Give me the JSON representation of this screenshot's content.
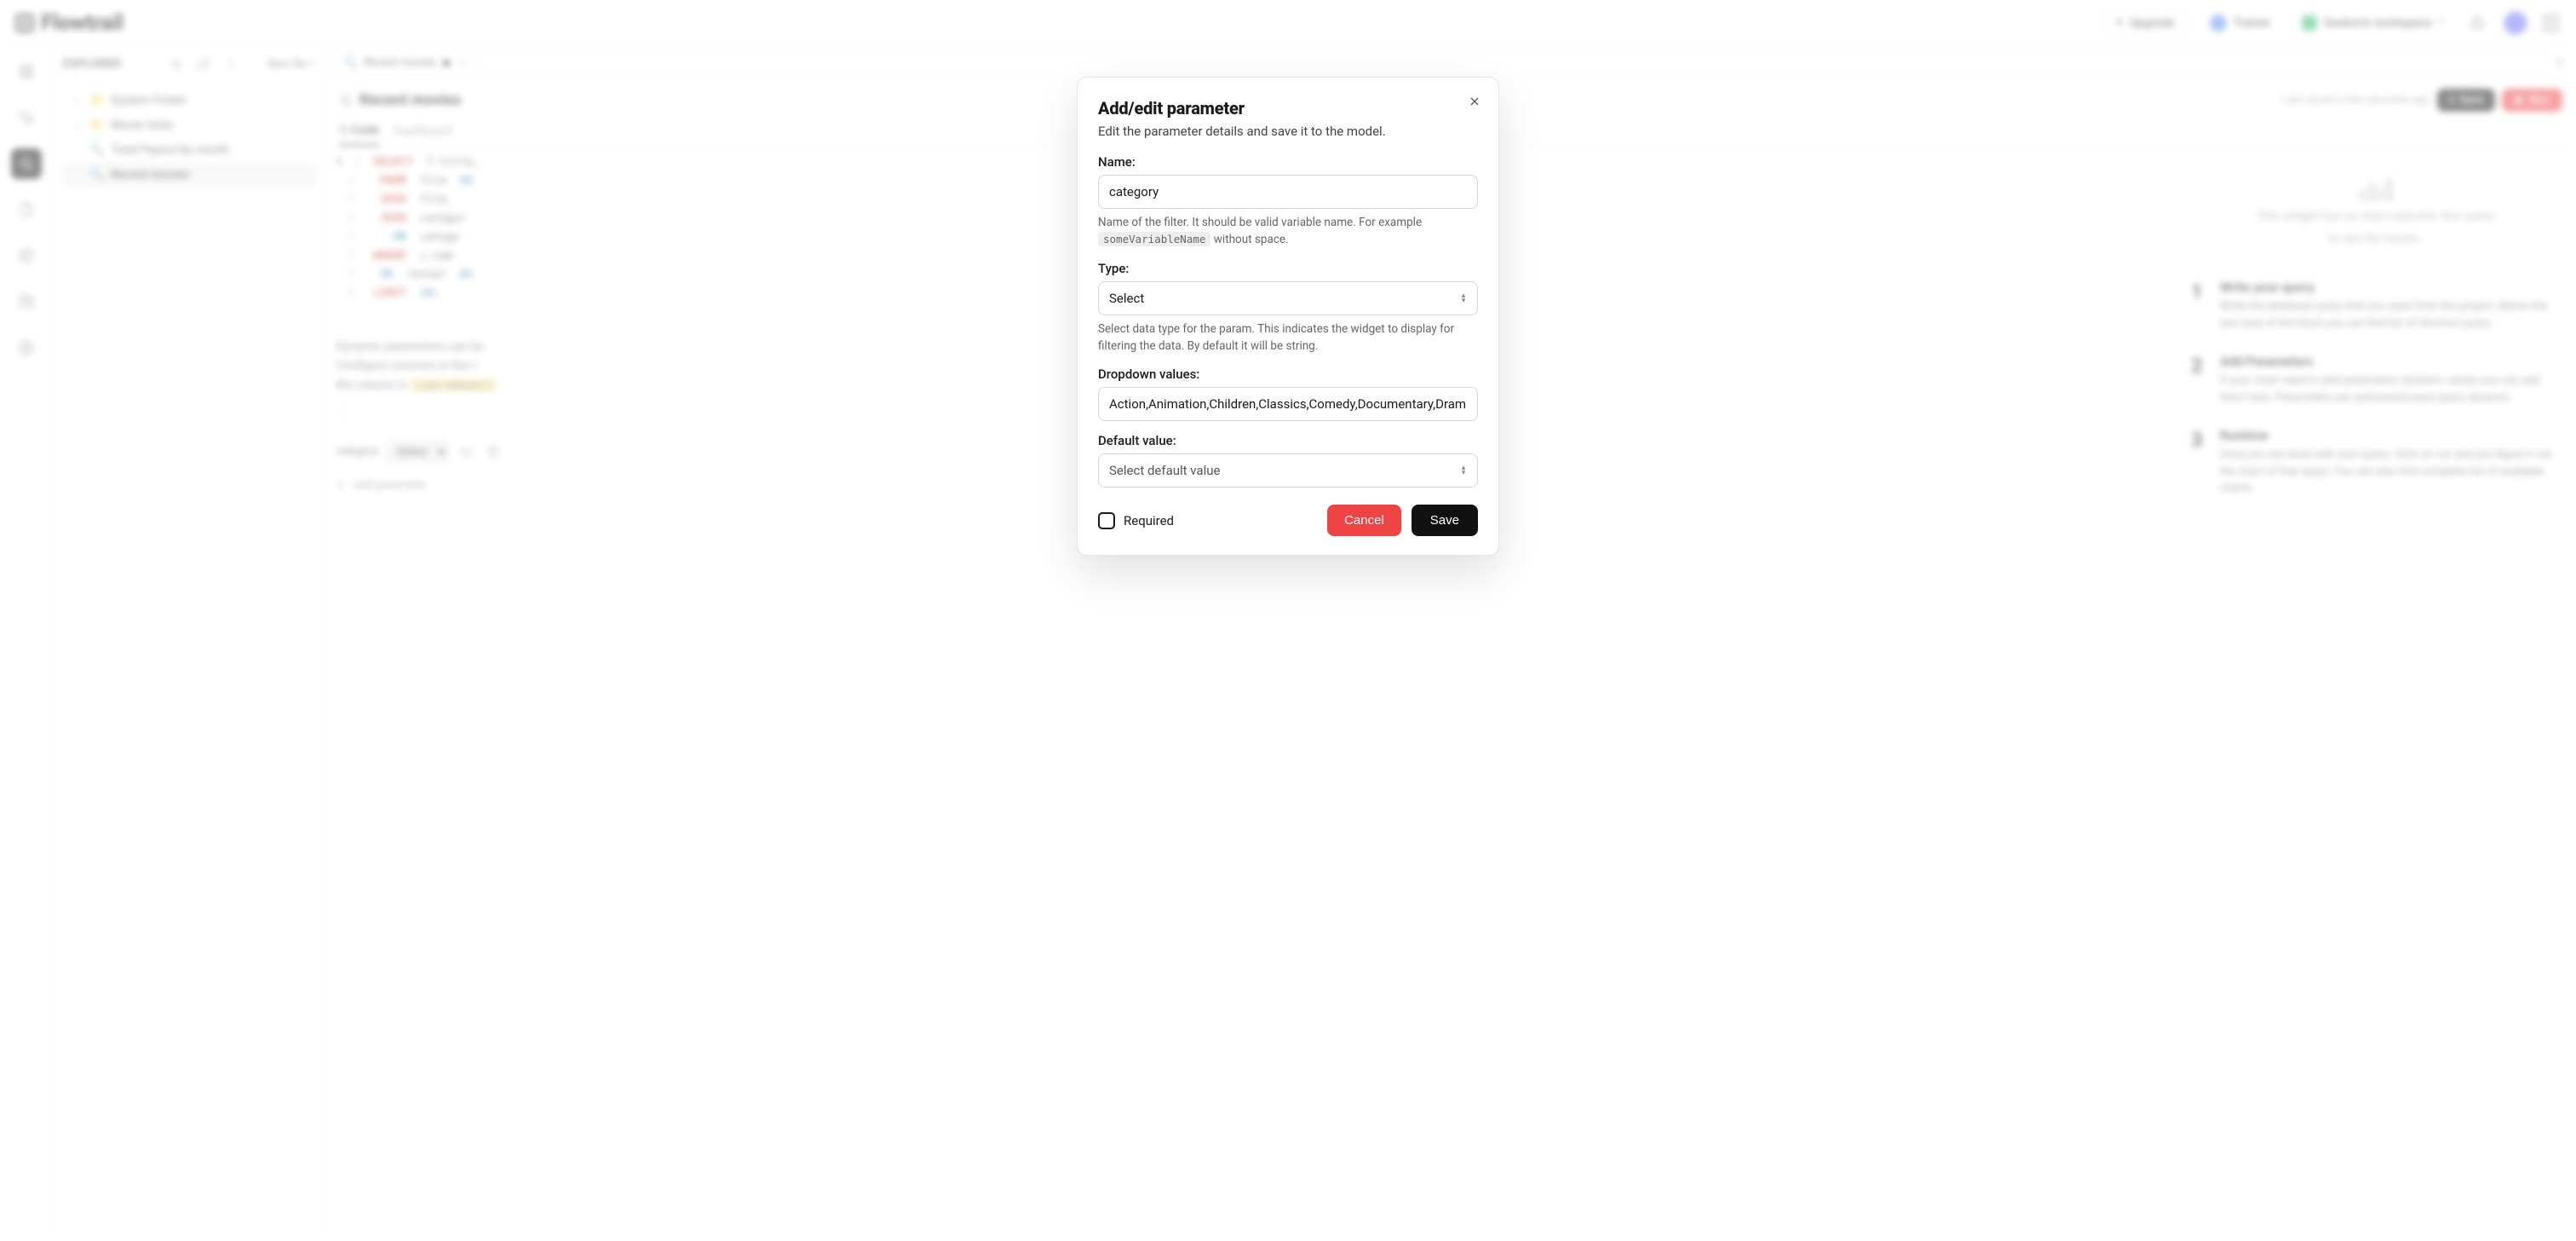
{
  "brand": "Flowtrail",
  "topbar": {
    "upgrade": "Upgrade",
    "trainer": "Trainer",
    "workspace": "Gaskon's workspace"
  },
  "explorer": {
    "heading": "EXPLORER",
    "new_label": "New file",
    "items": [
      {
        "type": "folder",
        "label": "System Folder"
      },
      {
        "type": "folder",
        "label": "Movie Units"
      },
      {
        "type": "file",
        "label": "Total Payout by month"
      },
      {
        "type": "file",
        "label": "Recent movies",
        "active": true
      }
    ]
  },
  "tab": {
    "label": "Recent movies"
  },
  "title": "Recent movies",
  "saved_text": "Last saved a few seconds ago",
  "save_button": "Save",
  "run_button": "Run",
  "editor_tabs": {
    "code": "Code",
    "dashboard": "Dashboard"
  },
  "code_lines": [
    "SELECT  f.title,",
    " FROM  film  AS  f",
    " JOIN  film_category",
    " JOIN  category  AS",
    "   ON  category.",
    "WHERE  c.name =",
    " IN  rental  AS",
    "LIMIT  10;"
  ],
  "code_desc": {
    "line1": "Dynamic parameters can be",
    "line2": "Configure columns in the c",
    "line3_prefix": "the column in ",
    "line3_hl": "{{paramName}}"
  },
  "param": {
    "name": "category",
    "select_placeholder": "Select"
  },
  "add_parameter": "Add parameter",
  "right": {
    "empty1": "This widget has no chart selected. Run query",
    "empty2": "to see the results.",
    "steps": [
      {
        "n": "1",
        "title": "Write your query",
        "body": "Write the database query that you want from the project. Below the text area of the block you can find list of shortcut query."
      },
      {
        "n": "2",
        "title": "Add Parameters",
        "body": "If your chart need to add parameters dynamic values you can add them here. Parameters are optionsand pass query dynamic."
      },
      {
        "n": "3",
        "title": "Runtime",
        "body": "Once you are done with your query. Click on run and you figure it out the chart of that query. You can also find complete list of available charts."
      }
    ]
  },
  "modal": {
    "title": "Add/edit parameter",
    "subtitle": "Edit the parameter details and save it to the model.",
    "name_label": "Name:",
    "name_value": "category",
    "name_help_prefix": "Name of the filter. It should be valid variable name. For example ",
    "name_help_code": "someVariableName",
    "name_help_suffix": " without space.",
    "type_label": "Type:",
    "type_value": "Select",
    "type_help": "Select data type for the param. This indicates the widget to display for filtering the data. By default it will be string.",
    "dropdown_label": "Dropdown values:",
    "dropdown_value": "Action,Animation,Children,Classics,Comedy,Documentary,Drama",
    "default_label": "Default value:",
    "default_placeholder": "Select default value",
    "required_label": "Required",
    "cancel": "Cancel",
    "save": "Save"
  }
}
